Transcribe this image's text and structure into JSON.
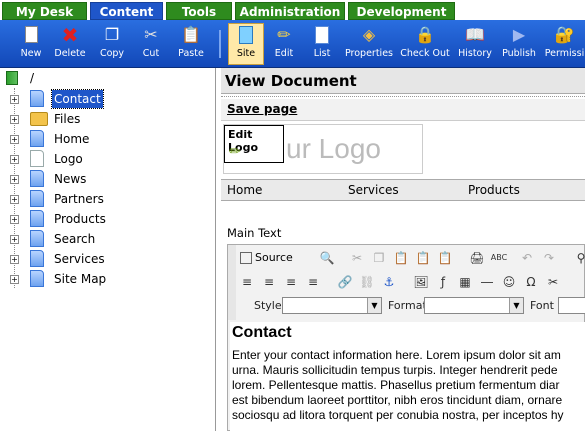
{
  "tabs": [
    {
      "label": "My Desk",
      "active": false
    },
    {
      "label": "Content",
      "active": true
    },
    {
      "label": "Tools",
      "active": false
    },
    {
      "label": "Administration",
      "active": false
    },
    {
      "label": "Development",
      "active": false
    }
  ],
  "toolbar": {
    "new": "New",
    "delete": "Delete",
    "copy": "Copy",
    "cut": "Cut",
    "paste": "Paste",
    "site": "Site",
    "edit": "Edit",
    "list": "List",
    "properties": "Properties",
    "checkout": "Check Out",
    "history": "History",
    "publish": "Publish",
    "permissions": "Permissi"
  },
  "tree": {
    "root": "/",
    "items": [
      "Contact",
      "Files",
      "Home",
      "Logo",
      "News",
      "Partners",
      "Products",
      "Search",
      "Services",
      "Site Map"
    ],
    "selected": "Contact"
  },
  "main": {
    "title": "View Document",
    "save": "Save page",
    "edit_logo": "Edit Logo",
    "logo_placeholder": "ur Logo",
    "nav": [
      "Home",
      "Services",
      "Products"
    ],
    "main_text_label": "Main Text",
    "editor": {
      "source": "Source",
      "style_label": "Style",
      "format_label": "Format",
      "font_label": "Font"
    },
    "content_heading": "Contact",
    "content_lines": [
      "Enter your contact information here. Lorem ipsum dolor sit am",
      "urna. Mauris sollicitudin tempus turpis. Integer hendrerit pede",
      "lorem. Pellentesque mattis. Phasellus pretium fermentum diar",
      "est bibendum laoreet porttitor, nibh eros tincidunt diam, ornare",
      "sociosqu ad litora torquent per conubia nostra, per inceptos hy"
    ]
  },
  "colors": {
    "tab_green": "#2e8b1e",
    "tab_active": "#1f56c9",
    "toolbar": "#1a5ad0"
  }
}
